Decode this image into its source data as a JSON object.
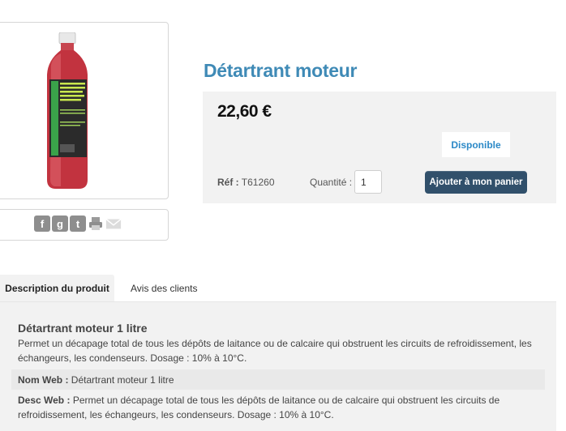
{
  "product": {
    "title": "Détartrant moteur",
    "price": "22,60 €",
    "availability": "Disponible",
    "ref_label": "Réf :",
    "ref_value": "T61260",
    "quantity_label": "Quantité :",
    "quantity_value": "1",
    "add_to_cart_label": "Ajouter à mon panier"
  },
  "share": {
    "icons": [
      "facebook-icon",
      "google-plus-icon",
      "twitter-icon",
      "print-icon",
      "email-icon"
    ],
    "icon_glyphs": {
      "facebook": "f",
      "google": "g",
      "twitter": "t"
    }
  },
  "tabs": [
    {
      "label": "Description du produit",
      "active": true
    },
    {
      "label": "Avis des clients",
      "active": false
    }
  ],
  "description": {
    "title": "Détartrant moteur 1 litre",
    "text": "Permet un décapage total de tous les dépôts de laitance ou de calcaire qui obstruent les circuits de refroidissement, les échangeurs, les condenseurs. Dosage : 10% à 10°C.",
    "nom_web_label": "Nom Web :",
    "nom_web_value": "Détartrant moteur 1 litre",
    "desc_web_label": "Desc Web :",
    "desc_web_value": "Permet un décapage total de tous les dépôts de laitance ou de calcaire qui obstruent les circuits de refroidissement, les échangeurs, les condenseurs. Dosage : 10% à 10°C."
  },
  "colors": {
    "title": "#3f8ab6",
    "availability": "#2c89c7",
    "button": "#31506b",
    "panel": "#f2f2f2"
  }
}
